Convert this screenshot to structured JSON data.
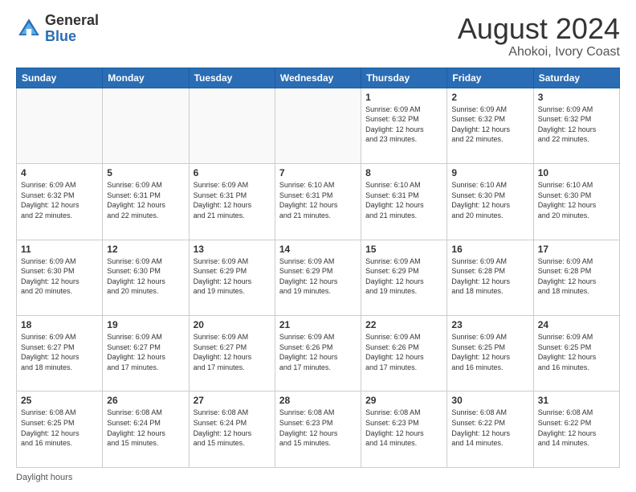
{
  "logo": {
    "general": "General",
    "blue": "Blue"
  },
  "header": {
    "title": "August 2024",
    "subtitle": "Ahokoi, Ivory Coast"
  },
  "days_of_week": [
    "Sunday",
    "Monday",
    "Tuesday",
    "Wednesday",
    "Thursday",
    "Friday",
    "Saturday"
  ],
  "footer": {
    "label": "Daylight hours"
  },
  "weeks": [
    [
      {
        "day": "",
        "info": ""
      },
      {
        "day": "",
        "info": ""
      },
      {
        "day": "",
        "info": ""
      },
      {
        "day": "",
        "info": ""
      },
      {
        "day": "1",
        "info": "Sunrise: 6:09 AM\nSunset: 6:32 PM\nDaylight: 12 hours\nand 23 minutes."
      },
      {
        "day": "2",
        "info": "Sunrise: 6:09 AM\nSunset: 6:32 PM\nDaylight: 12 hours\nand 22 minutes."
      },
      {
        "day": "3",
        "info": "Sunrise: 6:09 AM\nSunset: 6:32 PM\nDaylight: 12 hours\nand 22 minutes."
      }
    ],
    [
      {
        "day": "4",
        "info": "Sunrise: 6:09 AM\nSunset: 6:32 PM\nDaylight: 12 hours\nand 22 minutes."
      },
      {
        "day": "5",
        "info": "Sunrise: 6:09 AM\nSunset: 6:31 PM\nDaylight: 12 hours\nand 22 minutes."
      },
      {
        "day": "6",
        "info": "Sunrise: 6:09 AM\nSunset: 6:31 PM\nDaylight: 12 hours\nand 21 minutes."
      },
      {
        "day": "7",
        "info": "Sunrise: 6:10 AM\nSunset: 6:31 PM\nDaylight: 12 hours\nand 21 minutes."
      },
      {
        "day": "8",
        "info": "Sunrise: 6:10 AM\nSunset: 6:31 PM\nDaylight: 12 hours\nand 21 minutes."
      },
      {
        "day": "9",
        "info": "Sunrise: 6:10 AM\nSunset: 6:30 PM\nDaylight: 12 hours\nand 20 minutes."
      },
      {
        "day": "10",
        "info": "Sunrise: 6:10 AM\nSunset: 6:30 PM\nDaylight: 12 hours\nand 20 minutes."
      }
    ],
    [
      {
        "day": "11",
        "info": "Sunrise: 6:09 AM\nSunset: 6:30 PM\nDaylight: 12 hours\nand 20 minutes."
      },
      {
        "day": "12",
        "info": "Sunrise: 6:09 AM\nSunset: 6:30 PM\nDaylight: 12 hours\nand 20 minutes."
      },
      {
        "day": "13",
        "info": "Sunrise: 6:09 AM\nSunset: 6:29 PM\nDaylight: 12 hours\nand 19 minutes."
      },
      {
        "day": "14",
        "info": "Sunrise: 6:09 AM\nSunset: 6:29 PM\nDaylight: 12 hours\nand 19 minutes."
      },
      {
        "day": "15",
        "info": "Sunrise: 6:09 AM\nSunset: 6:29 PM\nDaylight: 12 hours\nand 19 minutes."
      },
      {
        "day": "16",
        "info": "Sunrise: 6:09 AM\nSunset: 6:28 PM\nDaylight: 12 hours\nand 18 minutes."
      },
      {
        "day": "17",
        "info": "Sunrise: 6:09 AM\nSunset: 6:28 PM\nDaylight: 12 hours\nand 18 minutes."
      }
    ],
    [
      {
        "day": "18",
        "info": "Sunrise: 6:09 AM\nSunset: 6:27 PM\nDaylight: 12 hours\nand 18 minutes."
      },
      {
        "day": "19",
        "info": "Sunrise: 6:09 AM\nSunset: 6:27 PM\nDaylight: 12 hours\nand 17 minutes."
      },
      {
        "day": "20",
        "info": "Sunrise: 6:09 AM\nSunset: 6:27 PM\nDaylight: 12 hours\nand 17 minutes."
      },
      {
        "day": "21",
        "info": "Sunrise: 6:09 AM\nSunset: 6:26 PM\nDaylight: 12 hours\nand 17 minutes."
      },
      {
        "day": "22",
        "info": "Sunrise: 6:09 AM\nSunset: 6:26 PM\nDaylight: 12 hours\nand 17 minutes."
      },
      {
        "day": "23",
        "info": "Sunrise: 6:09 AM\nSunset: 6:25 PM\nDaylight: 12 hours\nand 16 minutes."
      },
      {
        "day": "24",
        "info": "Sunrise: 6:09 AM\nSunset: 6:25 PM\nDaylight: 12 hours\nand 16 minutes."
      }
    ],
    [
      {
        "day": "25",
        "info": "Sunrise: 6:08 AM\nSunset: 6:25 PM\nDaylight: 12 hours\nand 16 minutes."
      },
      {
        "day": "26",
        "info": "Sunrise: 6:08 AM\nSunset: 6:24 PM\nDaylight: 12 hours\nand 15 minutes."
      },
      {
        "day": "27",
        "info": "Sunrise: 6:08 AM\nSunset: 6:24 PM\nDaylight: 12 hours\nand 15 minutes."
      },
      {
        "day": "28",
        "info": "Sunrise: 6:08 AM\nSunset: 6:23 PM\nDaylight: 12 hours\nand 15 minutes."
      },
      {
        "day": "29",
        "info": "Sunrise: 6:08 AM\nSunset: 6:23 PM\nDaylight: 12 hours\nand 14 minutes."
      },
      {
        "day": "30",
        "info": "Sunrise: 6:08 AM\nSunset: 6:22 PM\nDaylight: 12 hours\nand 14 minutes."
      },
      {
        "day": "31",
        "info": "Sunrise: 6:08 AM\nSunset: 6:22 PM\nDaylight: 12 hours\nand 14 minutes."
      }
    ]
  ]
}
